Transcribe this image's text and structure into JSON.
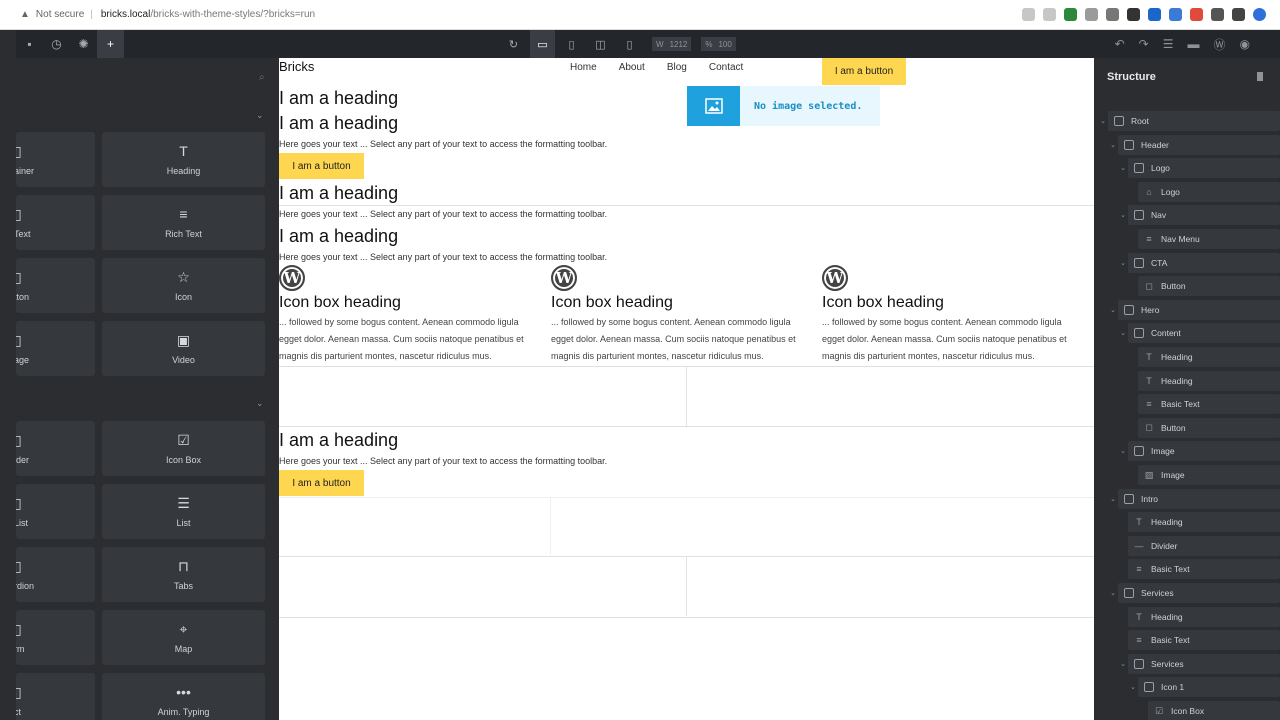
{
  "browser": {
    "security": "Not secure",
    "url_host": "bricks.local",
    "url_path": "/bricks-with-theme-styles/?bricks=run"
  },
  "toolbar": {
    "width_label": "W",
    "width_value": "1212",
    "zoom_label": "%",
    "zoom_value": "100"
  },
  "elements_panel": {
    "group1": [
      {
        "label": "ainer",
        "icon": "container-icon",
        "cut": true
      },
      {
        "label": "Heading",
        "icon": "heading-icon",
        "glyph": "T"
      },
      {
        "label": "Text",
        "icon": "text-icon",
        "cut": true
      },
      {
        "label": "Rich Text",
        "icon": "rich-text-icon",
        "glyph": "≡"
      },
      {
        "label": "tton",
        "icon": "button-icon",
        "cut": true
      },
      {
        "label": "Icon",
        "icon": "star-icon",
        "glyph": "☆"
      },
      {
        "label": "age",
        "icon": "image-icon",
        "cut": true
      },
      {
        "label": "Video",
        "icon": "video-icon",
        "glyph": "▣"
      }
    ],
    "group2": [
      {
        "label": "ider",
        "icon": "divider-icon",
        "cut": true
      },
      {
        "label": "Icon Box",
        "icon": "icon-box-icon",
        "glyph": "☑"
      },
      {
        "label": "List",
        "icon": "list-icon",
        "cut": true
      },
      {
        "label": "List",
        "icon": "list-icon",
        "glyph": "☰"
      },
      {
        "label": "rdion",
        "icon": "accordion-icon",
        "cut": true
      },
      {
        "label": "Tabs",
        "icon": "tabs-icon",
        "glyph": "⊓"
      },
      {
        "label": "rm",
        "icon": "form-icon",
        "cut": true
      },
      {
        "label": "Map",
        "icon": "map-pin-icon",
        "glyph": "⌖"
      },
      {
        "label": "ct",
        "icon": "countdown-icon",
        "cut": true
      },
      {
        "label": "Anim. Typing",
        "icon": "typing-icon",
        "glyph": "•••"
      }
    ]
  },
  "canvas": {
    "logo": "Bricks",
    "nav": [
      "Home",
      "About",
      "Blog",
      "Contact"
    ],
    "cta": "I am a button",
    "image_placeholder": "No image selected.",
    "heading": "I am a heading",
    "text": "Here goes your text ... Select any part of your text to access the formatting toolbar.",
    "button": "I am a button",
    "iconbox_heading": "Icon box heading",
    "iconbox_text_1": "... followed by some bogus content. Aenean commodo ligula",
    "iconbox_text_2": "egget dolor. Aenean massa. Cum sociis natoque penatibus et",
    "iconbox_text_3": "magnis dis parturient montes, nascetur ridiculus mus."
  },
  "structure": {
    "title": "Structure",
    "nodes": [
      {
        "label": "Root",
        "depth": 0,
        "chev": true,
        "kind": "box"
      },
      {
        "label": "Header",
        "depth": 1,
        "chev": true,
        "kind": "box"
      },
      {
        "label": "Logo",
        "depth": 2,
        "chev": true,
        "kind": "box"
      },
      {
        "label": "Logo",
        "depth": 3,
        "chev": false,
        "kind": "glyph",
        "glyph": "⌂"
      },
      {
        "label": "Nav",
        "depth": 2,
        "chev": true,
        "kind": "box"
      },
      {
        "label": "Nav Menu",
        "depth": 3,
        "chev": false,
        "kind": "glyph",
        "glyph": "≡"
      },
      {
        "label": "CTA",
        "depth": 2,
        "chev": true,
        "kind": "box"
      },
      {
        "label": "Button",
        "depth": 3,
        "chev": false,
        "kind": "glyph",
        "glyph": "◻"
      },
      {
        "label": "Hero",
        "depth": 1,
        "chev": true,
        "kind": "box"
      },
      {
        "label": "Content",
        "depth": 2,
        "chev": true,
        "kind": "box"
      },
      {
        "label": "Heading",
        "depth": 3,
        "chev": false,
        "kind": "glyph",
        "glyph": "T"
      },
      {
        "label": "Heading",
        "depth": 3,
        "chev": false,
        "kind": "glyph",
        "glyph": "T"
      },
      {
        "label": "Basic Text",
        "depth": 3,
        "chev": false,
        "kind": "glyph",
        "glyph": "≡"
      },
      {
        "label": "Button",
        "depth": 3,
        "chev": false,
        "kind": "glyph",
        "glyph": "◻"
      },
      {
        "label": "Image",
        "depth": 2,
        "chev": true,
        "kind": "box"
      },
      {
        "label": "Image",
        "depth": 3,
        "chev": false,
        "kind": "glyph",
        "glyph": "▨"
      },
      {
        "label": "Intro",
        "depth": 1,
        "chev": true,
        "kind": "box"
      },
      {
        "label": "Heading",
        "depth": 2,
        "chev": false,
        "kind": "glyph",
        "glyph": "T"
      },
      {
        "label": "Divider",
        "depth": 2,
        "chev": false,
        "kind": "glyph",
        "glyph": "—"
      },
      {
        "label": "Basic Text",
        "depth": 2,
        "chev": false,
        "kind": "glyph",
        "glyph": "≡"
      },
      {
        "label": "Services",
        "depth": 1,
        "chev": true,
        "kind": "box"
      },
      {
        "label": "Heading",
        "depth": 2,
        "chev": false,
        "kind": "glyph",
        "glyph": "T"
      },
      {
        "label": "Basic Text",
        "depth": 2,
        "chev": false,
        "kind": "glyph",
        "glyph": "≡"
      },
      {
        "label": "Services",
        "depth": 2,
        "chev": true,
        "kind": "box"
      },
      {
        "label": "Icon 1",
        "depth": 3,
        "chev": true,
        "kind": "box"
      },
      {
        "label": "Icon Box",
        "depth": 4,
        "chev": false,
        "kind": "glyph",
        "glyph": "☑"
      }
    ]
  }
}
